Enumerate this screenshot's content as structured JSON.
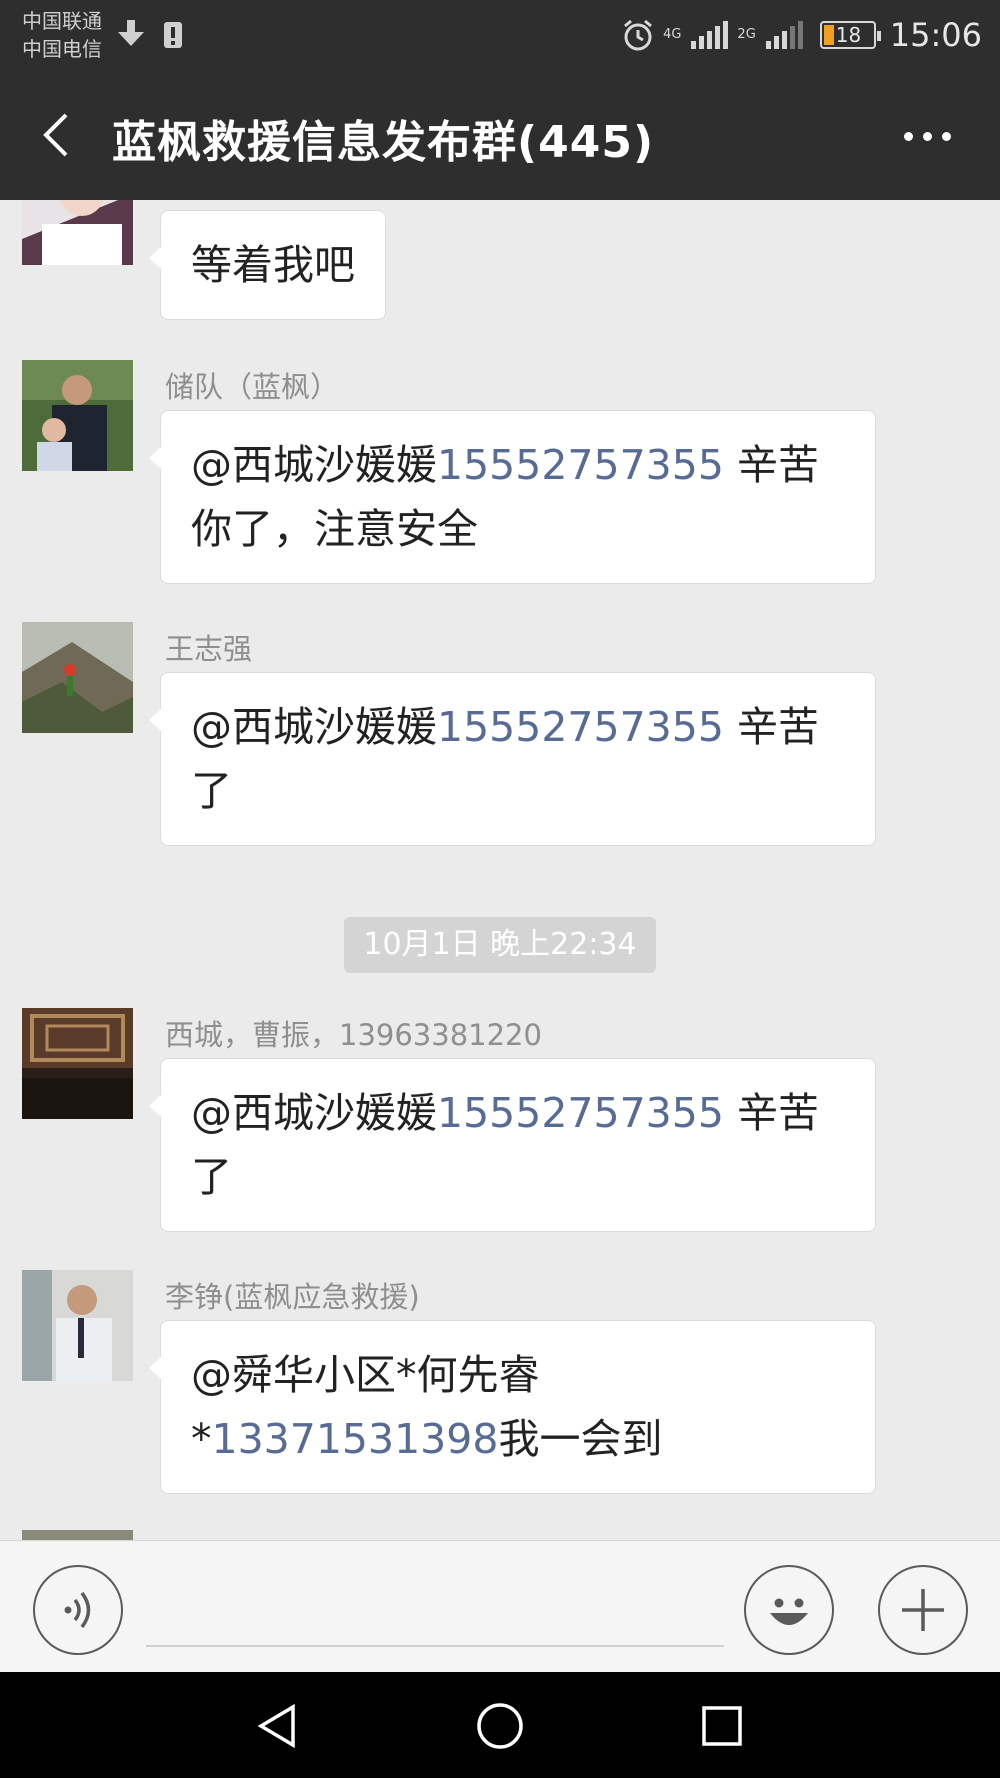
{
  "status_bar": {
    "carrier_1": "中国联通",
    "carrier_2": "中国电信",
    "network_1": "4G",
    "network_2": "2G",
    "battery": "18",
    "time": "15:06"
  },
  "header": {
    "title": "蓝枫救援信息发布群(445)",
    "back_icon": "chevron-left-icon",
    "more_icon": "more-dots-icon"
  },
  "messages": [
    {
      "sender": "",
      "segments": [
        {
          "text": "等着我吧"
        }
      ]
    },
    {
      "sender": "储队（蓝枫）",
      "segments": [
        {
          "text": "@西城沙媛媛"
        },
        {
          "text": "15552757355",
          "link": true
        },
        {
          "text": " 辛苦你了，注意安全"
        }
      ]
    },
    {
      "sender": "王志强",
      "segments": [
        {
          "text": "@西城沙媛媛"
        },
        {
          "text": "15552757355",
          "link": true
        },
        {
          "text": " 辛苦了"
        }
      ]
    },
    {
      "sender": "西城，曹振，13963381220",
      "segments": [
        {
          "text": "@西城沙媛媛"
        },
        {
          "text": "15552757355",
          "link": true
        },
        {
          "text": " 辛苦了"
        }
      ]
    },
    {
      "sender": "李铮(蓝枫应急救援)",
      "segments": [
        {
          "text": "@舜华小区*何先睿*"
        },
        {
          "text": "13371531398",
          "link": true
        },
        {
          "text": "我一会到"
        }
      ]
    }
  ],
  "timestamp": "10月1日 晚上22:34",
  "input_bar": {
    "voice_icon": "voice-icon",
    "emoji_icon": "emoji-icon",
    "plus_icon": "plus-icon",
    "input_value": ""
  },
  "nav_bar": {
    "back_icon": "triangle-back-icon",
    "home_icon": "circle-home-icon",
    "recents_icon": "square-recents-icon"
  },
  "colors": {
    "header_bg": "#2e2e2e",
    "chat_bg": "#ebebeb",
    "link": "#576b95"
  }
}
